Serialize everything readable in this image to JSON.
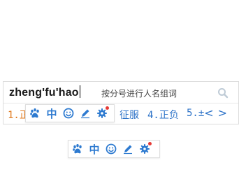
{
  "ime": {
    "composition": "zheng'fu'hao",
    "hint": "按分号进行人名组词",
    "candidates": [
      {
        "label": "1.正"
      },
      {
        "label": "征服"
      },
      {
        "label": "4.正负"
      },
      {
        "label": "5.±"
      }
    ],
    "page_prev": "<",
    "page_next": ">"
  },
  "toolbar": {
    "lang_mode": "中",
    "icons": [
      "paw-icon",
      "chinese-mode",
      "emoji-icon",
      "pen-icon",
      "gear-icon"
    ]
  },
  "colors": {
    "accent": "#2d73c8",
    "first_candidate": "#e07a1e",
    "notification": "#e53935"
  }
}
